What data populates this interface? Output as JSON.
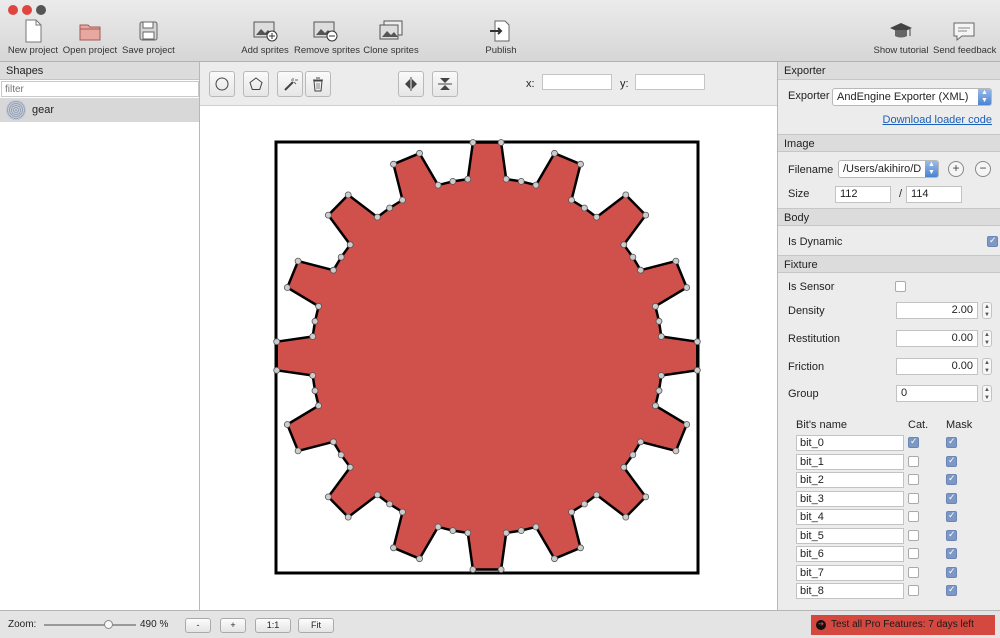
{
  "toolbar": {
    "buttons": [
      {
        "label": "New project",
        "icon": "new-document-icon"
      },
      {
        "label": "Open project",
        "icon": "folder-icon"
      },
      {
        "label": "Save project",
        "icon": "save-disk-icon"
      },
      {
        "label": "Add sprites",
        "icon": "add-image-icon"
      },
      {
        "label": "Remove sprites",
        "icon": "remove-image-icon"
      },
      {
        "label": "Clone sprites",
        "icon": "clone-image-icon"
      },
      {
        "label": "Publish",
        "icon": "publish-icon"
      },
      {
        "label": "Show tutorial",
        "icon": "graduation-cap-icon"
      },
      {
        "label": "Send feedback",
        "icon": "speech-bubble-icon"
      }
    ]
  },
  "shapes": {
    "header": "Shapes",
    "filter_placeholder": "filter",
    "items": [
      {
        "name": "gear"
      }
    ]
  },
  "canvas": {
    "x_label": "x:",
    "y_label": "y:",
    "x_value": "",
    "y_value": "",
    "fill_color": "#d0504c",
    "vertex_count": 80
  },
  "exporter": {
    "header": "Exporter",
    "label": "Exporter",
    "selected": "AndEngine Exporter (XML)",
    "link": "Download loader code"
  },
  "image": {
    "header": "Image",
    "filename_label": "Filename",
    "filename": "/Users/akihiro/D",
    "size_label": "Size",
    "width": "112",
    "separator": "/",
    "height": "114"
  },
  "body": {
    "header": "Body",
    "is_dynamic_label": "Is Dynamic",
    "is_dynamic": true
  },
  "fixture": {
    "header": "Fixture",
    "is_sensor_label": "Is Sensor",
    "is_sensor": false,
    "density_label": "Density",
    "density": "2.00",
    "restitution_label": "Restitution",
    "restitution": "0.00",
    "friction_label": "Friction",
    "friction": "0.00",
    "group_label": "Group",
    "group": "0",
    "bits_header": {
      "name": "Bit's name",
      "cat": "Cat.",
      "mask": "Mask"
    },
    "bits": [
      {
        "name": "bit_0",
        "cat": true,
        "mask": true
      },
      {
        "name": "bit_1",
        "cat": false,
        "mask": true
      },
      {
        "name": "bit_2",
        "cat": false,
        "mask": true
      },
      {
        "name": "bit_3",
        "cat": false,
        "mask": true
      },
      {
        "name": "bit_4",
        "cat": false,
        "mask": true
      },
      {
        "name": "bit_5",
        "cat": false,
        "mask": true
      },
      {
        "name": "bit_6",
        "cat": false,
        "mask": true
      },
      {
        "name": "bit_7",
        "cat": false,
        "mask": true
      },
      {
        "name": "bit_8",
        "cat": false,
        "mask": true
      }
    ]
  },
  "status": {
    "zoom_label": "Zoom:",
    "zoom_value": "490 %",
    "zoom_fraction": 0.7,
    "buttons": [
      "-",
      "+",
      "1:1",
      "Fit"
    ],
    "promo": "Test all Pro Features: 7 days left"
  }
}
